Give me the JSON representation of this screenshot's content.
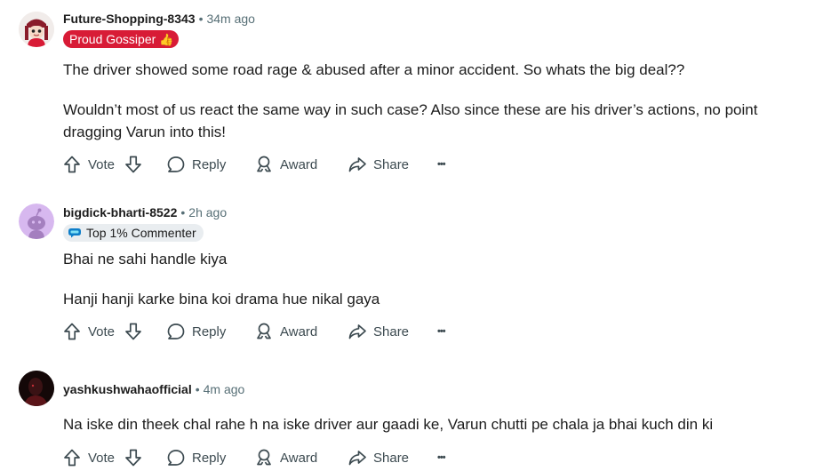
{
  "comments": [
    {
      "username": "Future-Shopping-8343",
      "dot": "•",
      "time": "34m ago",
      "flair": "Proud Gossiper",
      "flair_emoji": "👍",
      "paragraphs": [
        "The driver showed some road rage & abused after a minor accident. So whats the big deal??",
        "Wouldn’t most of us react the same way in such case? Also since these are his driver’s actions, no point dragging Varun into this!"
      ],
      "actions": {
        "vote": "Vote",
        "reply": "Reply",
        "award": "Award",
        "share": "Share",
        "more": "•••"
      }
    },
    {
      "username": "bigdick-bharti-8522",
      "dot": "•",
      "time": "2h ago",
      "flair": "Top 1% Commenter",
      "paragraphs": [
        "Bhai ne sahi handle kiya",
        "Hanji hanji karke bina koi drama hue nikal gaya"
      ],
      "actions": {
        "vote": "Vote",
        "reply": "Reply",
        "award": "Award",
        "share": "Share",
        "more": "•••"
      }
    },
    {
      "username": "yashkushwahaofficial",
      "dot": "•",
      "time": "4m ago",
      "paragraphs": [
        "Na iske din theek chal rahe h na iske driver aur gaadi ke, Varun chutti pe chala ja bhai kuch din ki"
      ],
      "actions": {
        "vote": "Vote",
        "reply": "Reply",
        "award": "Award",
        "share": "Share",
        "more": "•••"
      }
    }
  ],
  "colors": {
    "flair_red": "#d81b36",
    "meta_grey": "#576f76",
    "action_grey": "#3c4a50"
  }
}
